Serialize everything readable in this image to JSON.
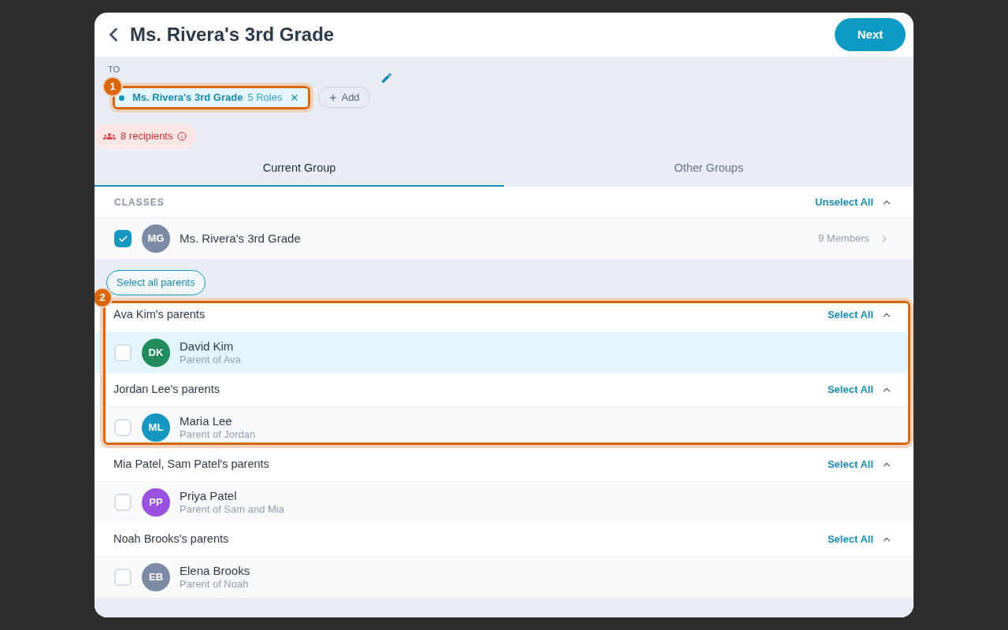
{
  "dialog": {
    "title": "Ms. Rivera's 3rd Grade",
    "next_button": "Next"
  },
  "to": {
    "label": "TO",
    "chips": [
      {
        "name": "Ms. Rivera's 3rd Grade",
        "roles": "5 Roles",
        "callout": "1"
      }
    ],
    "add_button": "Add"
  },
  "recipients": {
    "count_label": "8 recipients"
  },
  "tabs": [
    {
      "label": "Current Group",
      "selected": true
    },
    {
      "label": "Other Groups",
      "selected": false
    }
  ],
  "classes": {
    "heading": "CLASSES",
    "action": "Unselect All",
    "expanded": true,
    "items": [
      {
        "initials": "MG",
        "color": "#7d8aa3",
        "name": "Ms. Rivera's 3rd Grade",
        "members": "9 Members",
        "checked": true
      }
    ]
  },
  "select_all_parents_button": "Select all parents",
  "parent_sections": [
    {
      "callout": "2",
      "groups": [
        {
          "title": "Ava Kim's parents",
          "action": "Select All",
          "expanded": true,
          "members": [
            {
              "initials": "DK",
              "color": "#228b5b",
              "name": "David Kim",
              "relation": "Parent of Ava",
              "checked": false,
              "highlighted": true
            }
          ]
        },
        {
          "title": "Jordan Lee's parents",
          "action": "Select All",
          "expanded": true,
          "members": [
            {
              "initials": "ML",
              "color": "#1597c0",
              "name": "Maria Lee",
              "relation": "Parent of Jordan",
              "checked": false,
              "highlighted": false
            }
          ]
        }
      ]
    },
    {
      "groups": [
        {
          "title": "Mia Patel, Sam Patel's parents",
          "action": "Select All",
          "expanded": true,
          "members": [
            {
              "initials": "PP",
              "color": "#9b51e0",
              "name": "Priya Patel",
              "relation": "Parent of Sam and Mia",
              "checked": false,
              "highlighted": false
            }
          ]
        },
        {
          "title": "Noah Brooks's parents",
          "action": "Select All",
          "expanded": true,
          "members": [
            {
              "initials": "EB",
              "color": "#7d8aa3",
              "name": "Elena Brooks",
              "relation": "Parent of Noah",
              "checked": false,
              "highlighted": false
            }
          ]
        }
      ]
    }
  ]
}
